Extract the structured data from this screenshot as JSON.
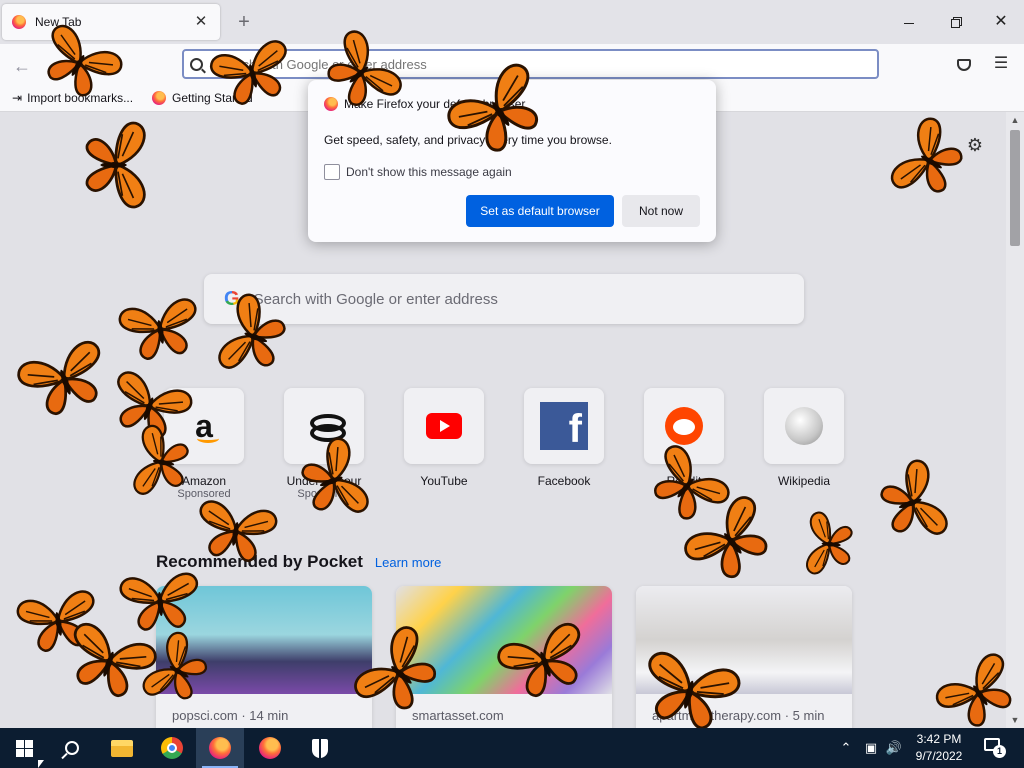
{
  "browser": {
    "tab_title": "New Tab",
    "tab_close": "✕",
    "new_tab": "+",
    "url_placeholder": "Search with Google or enter address",
    "bookmarks": {
      "import_label": "Import bookmarks...",
      "getting_started_label": "Getting Started"
    }
  },
  "newtab": {
    "search_placeholder": "Search with Google or enter address",
    "google_letter": "G",
    "shortcuts": [
      {
        "label": "Amazon",
        "sublabel": "Sponsored"
      },
      {
        "label": "Under Armour",
        "sublabel": "Sponsored"
      },
      {
        "label": "YouTube",
        "sublabel": ""
      },
      {
        "label": "Facebook",
        "sublabel": ""
      },
      {
        "label": "Reddit",
        "sublabel": ""
      },
      {
        "label": "Wikipedia",
        "sublabel": ""
      }
    ],
    "pocket": {
      "heading": "Recommended by Pocket",
      "learn_more": "Learn more",
      "cards": [
        {
          "source": "popsci.com · 14 min"
        },
        {
          "source": "smartasset.com"
        },
        {
          "source": "apartmenttherapy.com · 5 min"
        }
      ]
    }
  },
  "dialog": {
    "title": "Make Firefox your default browser",
    "body": "Get speed, safety, and privacy every time you browse.",
    "checkbox_label": "Don't show this message again",
    "checkbox_checked": false,
    "primary_button": "Set as default browser",
    "secondary_button": "Not now"
  },
  "taskbar": {
    "time": "3:42 PM",
    "date": "9/7/2022",
    "notification_count": "1",
    "apps": [
      "start-icon",
      "search-icon",
      "file-explorer-icon",
      "chrome-icon",
      "firefox-icon",
      "firefox-icon",
      "security-icon"
    ]
  },
  "colors": {
    "primary_button": "#0061e0",
    "taskbar": "#0c1d31",
    "butterfly_orange": "#f07f14"
  }
}
